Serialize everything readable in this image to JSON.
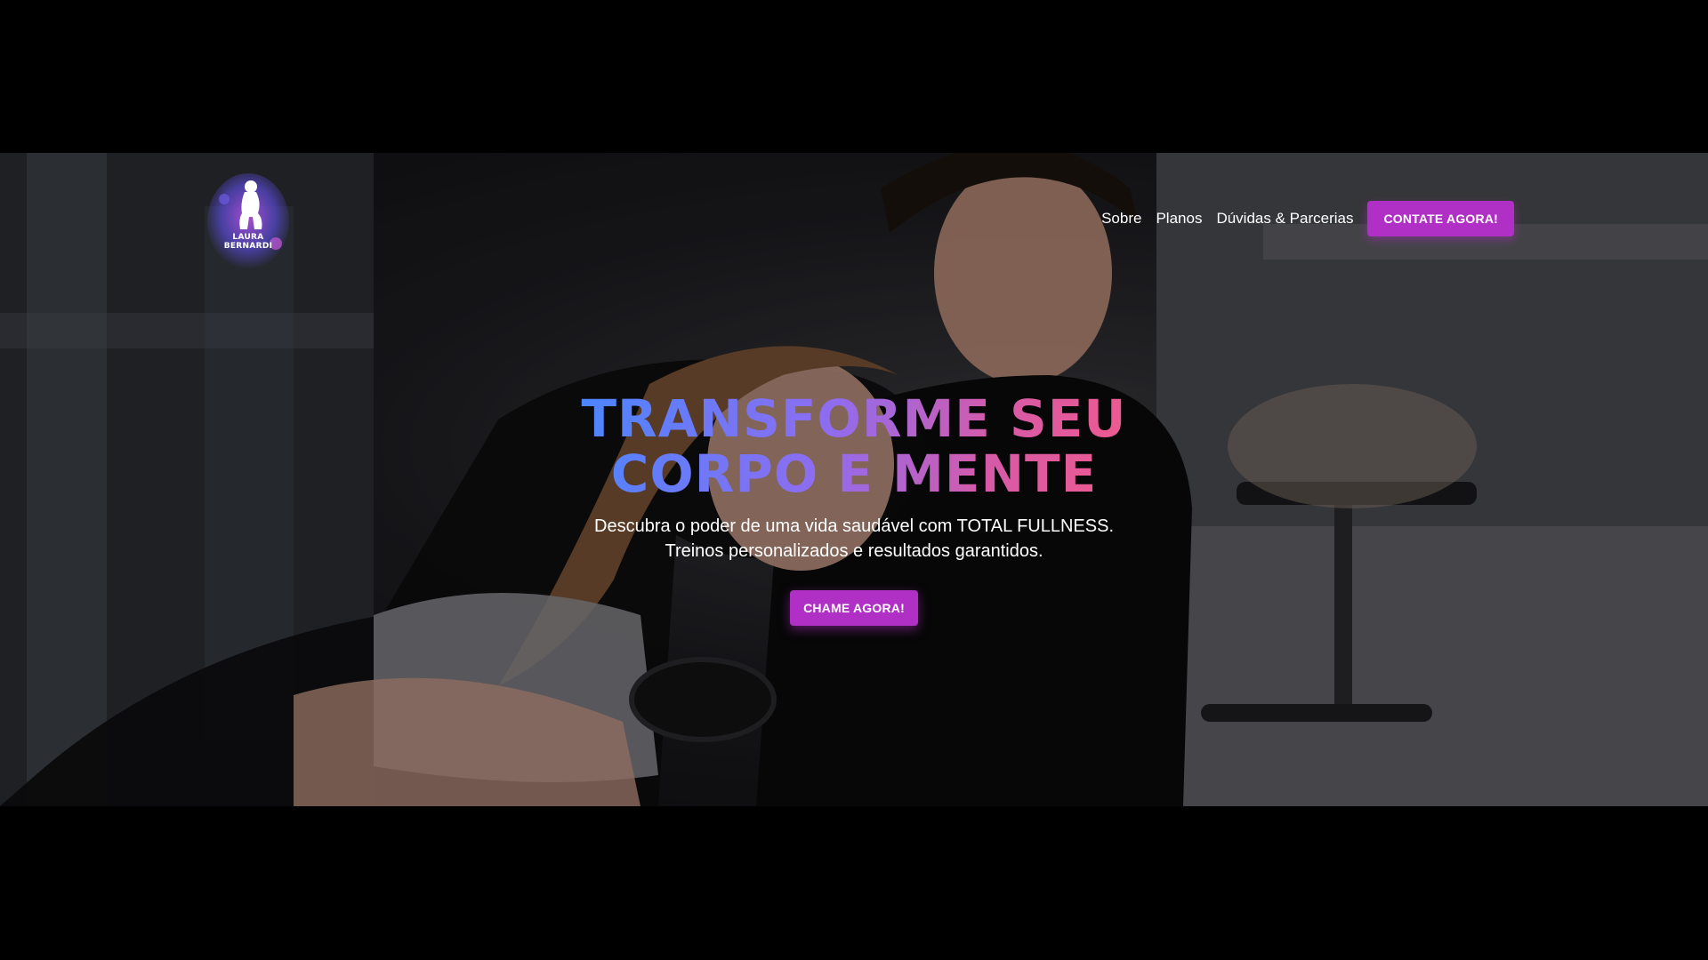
{
  "logo": {
    "line1": "LAURA",
    "line2": "BERNARDI",
    "icon": "woman-silhouette-icon",
    "splash_colors": [
      "#5a4bd6",
      "#b84fd9"
    ]
  },
  "nav": {
    "items": [
      {
        "label": "Sobre"
      },
      {
        "label": "Planos"
      },
      {
        "label": "Dúvidas & Parcerias"
      }
    ],
    "cta_label": "CONTATE AGORA!"
  },
  "hero": {
    "title_line1": "TRANSFORME SEU",
    "title_line2": "CORPO E MENTE",
    "subtitle_line1": "Descubra o poder de uma vida saudável com TOTAL FULLNESS.",
    "subtitle_line2": "Treinos personalizados e resultados garantidos.",
    "cta_label": "CHAME AGORA!",
    "background_image": "gym-trainer-and-woman-photo"
  },
  "colors": {
    "accent": "#b02fc4",
    "title_gradient_start": "#4b86ff",
    "title_gradient_end": "#ef5a8e",
    "page_background": "#000000"
  }
}
